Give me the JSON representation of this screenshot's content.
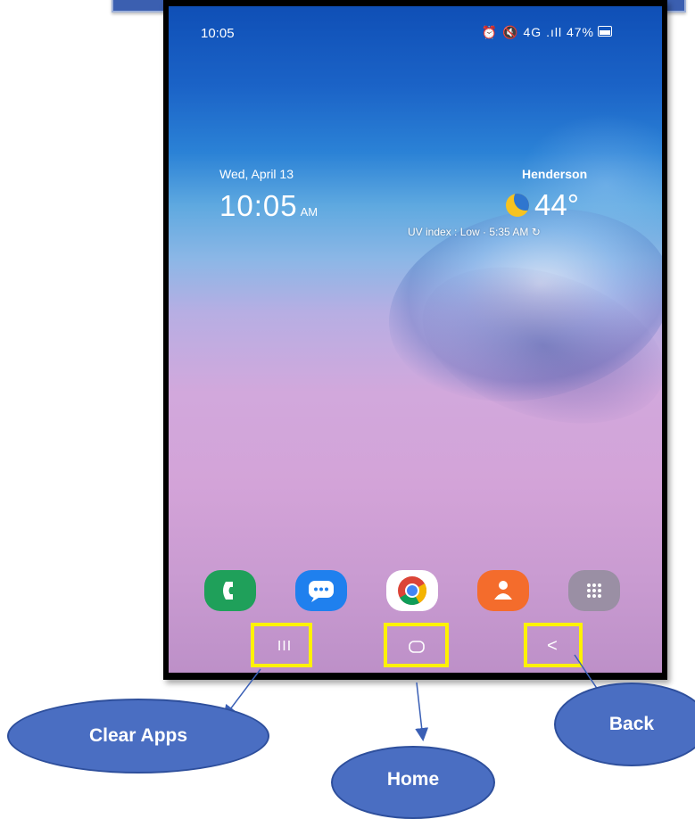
{
  "status_bar": {
    "time": "10:05",
    "icons": "⏰ 🔇 4G .ıll",
    "battery": "47%"
  },
  "clock": {
    "date": "Wed, April 13",
    "time": "10:05",
    "ampm": "AM"
  },
  "weather": {
    "city": "Henderson",
    "temperature": "44°",
    "detail": "UV index : Low · 5:35 AM ↻"
  },
  "dock_apps": [
    "Phone",
    "Messages",
    "Chrome",
    "Contacts",
    "Apps"
  ],
  "nav": {
    "recent_glyph": "III",
    "back_glyph": "<"
  },
  "callouts": {
    "clear_apps": "Clear Apps",
    "home": "Home",
    "back": "Back"
  },
  "colors": {
    "highlight": "#fff200",
    "callout_fill": "#4a6ec2",
    "banner": "#3b5fb0"
  }
}
